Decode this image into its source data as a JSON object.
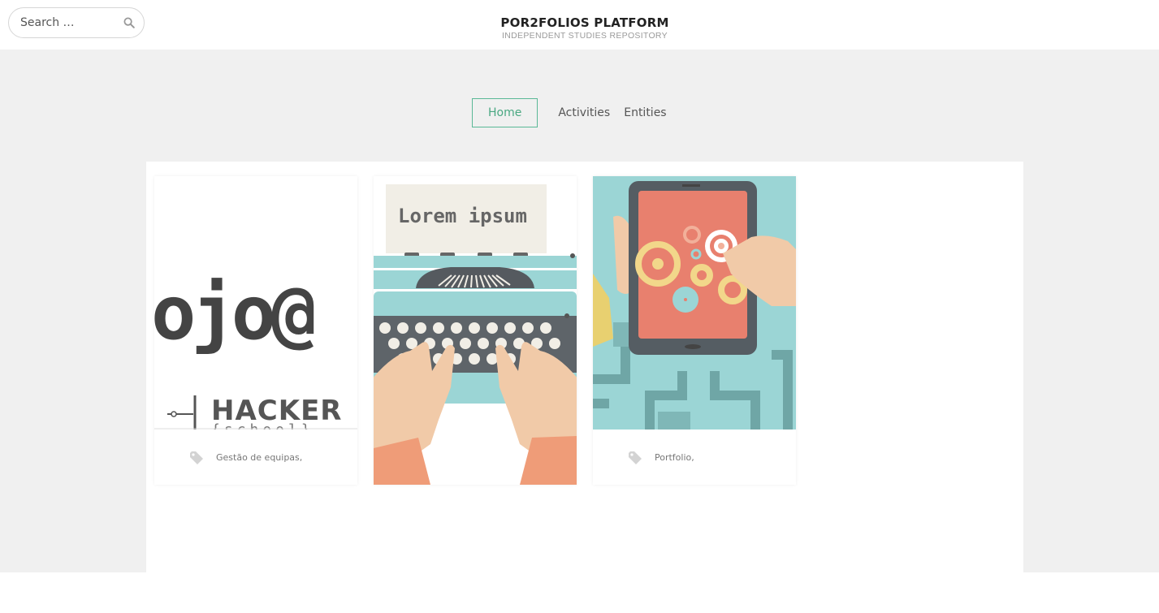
{
  "header": {
    "search_placeholder": "Search …",
    "title": "POR2FOLIOS PLATFORM",
    "subtitle": "INDEPENDENT STUDIES REPOSITORY"
  },
  "nav": {
    "items": [
      {
        "label": "Home",
        "active": true
      },
      {
        "label": "Activities",
        "active": false
      },
      {
        "label": "Entities",
        "active": false
      }
    ]
  },
  "cards": [
    {
      "image_text_top": "ojo@",
      "image_text_bottom": "HACKER",
      "image_text_bottom2": "{school}",
      "tag": "Gestão de equipas,"
    },
    {
      "image_text": "Lorem ipsum"
    },
    {
      "tag": "Portfolio,"
    }
  ],
  "colors": {
    "accent": "#5ab896",
    "page_bg": "#f0f0f0",
    "typewriter": "#9bd5d5",
    "tablet_screen": "#e8806e"
  },
  "icons": {
    "search": "search-icon",
    "tag": "tag-icon"
  }
}
